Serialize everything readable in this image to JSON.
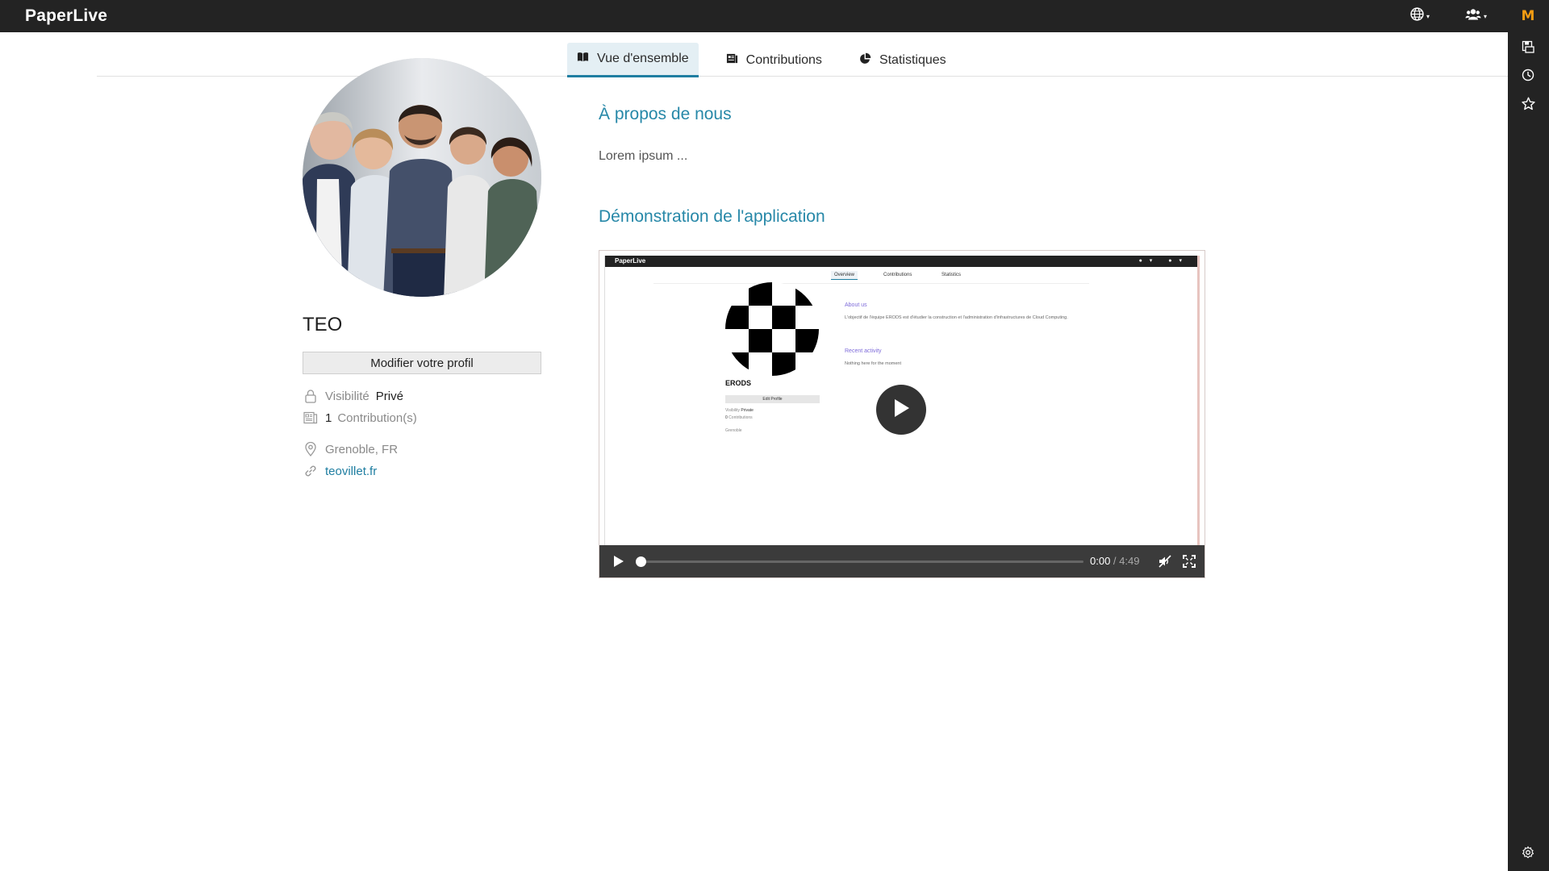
{
  "app": {
    "brand": "PaperLive"
  },
  "topbar": {
    "language_caret": "▾",
    "users_caret": "▾"
  },
  "rail": {
    "logo_letter": "M",
    "icons": [
      "save-icon",
      "history-icon",
      "star-icon",
      "settings-icon"
    ]
  },
  "tabs": [
    {
      "label": "Vue d'ensemble",
      "icon": "book-icon",
      "active": true
    },
    {
      "label": "Contributions",
      "icon": "document-icon",
      "active": false
    },
    {
      "label": "Statistiques",
      "icon": "pie-chart-icon",
      "active": false
    }
  ],
  "profile": {
    "name": "TEO",
    "edit_button": "Modifier votre profil",
    "visibility_label": "Visibilité",
    "visibility_value": "Privé",
    "contributions_count": "1",
    "contributions_label": "Contribution(s)",
    "location": "Grenoble, FR",
    "website": "teovillet.fr"
  },
  "main": {
    "about_title": "À propos de nous",
    "about_text": "Lorem ipsum ...",
    "demo_title": "Démonstration de l'application"
  },
  "video": {
    "current_time": "0:00",
    "separator": " / ",
    "total_time": "4:49",
    "progress": 0,
    "preview": {
      "brand": "PaperLive",
      "tabs": [
        "Overview",
        "Contributions",
        "Statistics"
      ],
      "name": "ERODS",
      "edit": "Edit Profile",
      "visibility": "Visibility",
      "visibility_value": "Private",
      "contrib_count": "0",
      "contrib_label": "Contributions",
      "location": "Grenoble",
      "about_title": "About us",
      "about_text": "L'objectif de l'équipe ERODS est d'étudier la construction et l'administration d'infrastructures de Cloud Computing.",
      "recent_title": "Recent activity",
      "recent_text": "Nothing here for the moment"
    }
  },
  "colors": {
    "accent": "#2788a8",
    "topbar": "#232323",
    "rail_logo": "#f39c12"
  }
}
